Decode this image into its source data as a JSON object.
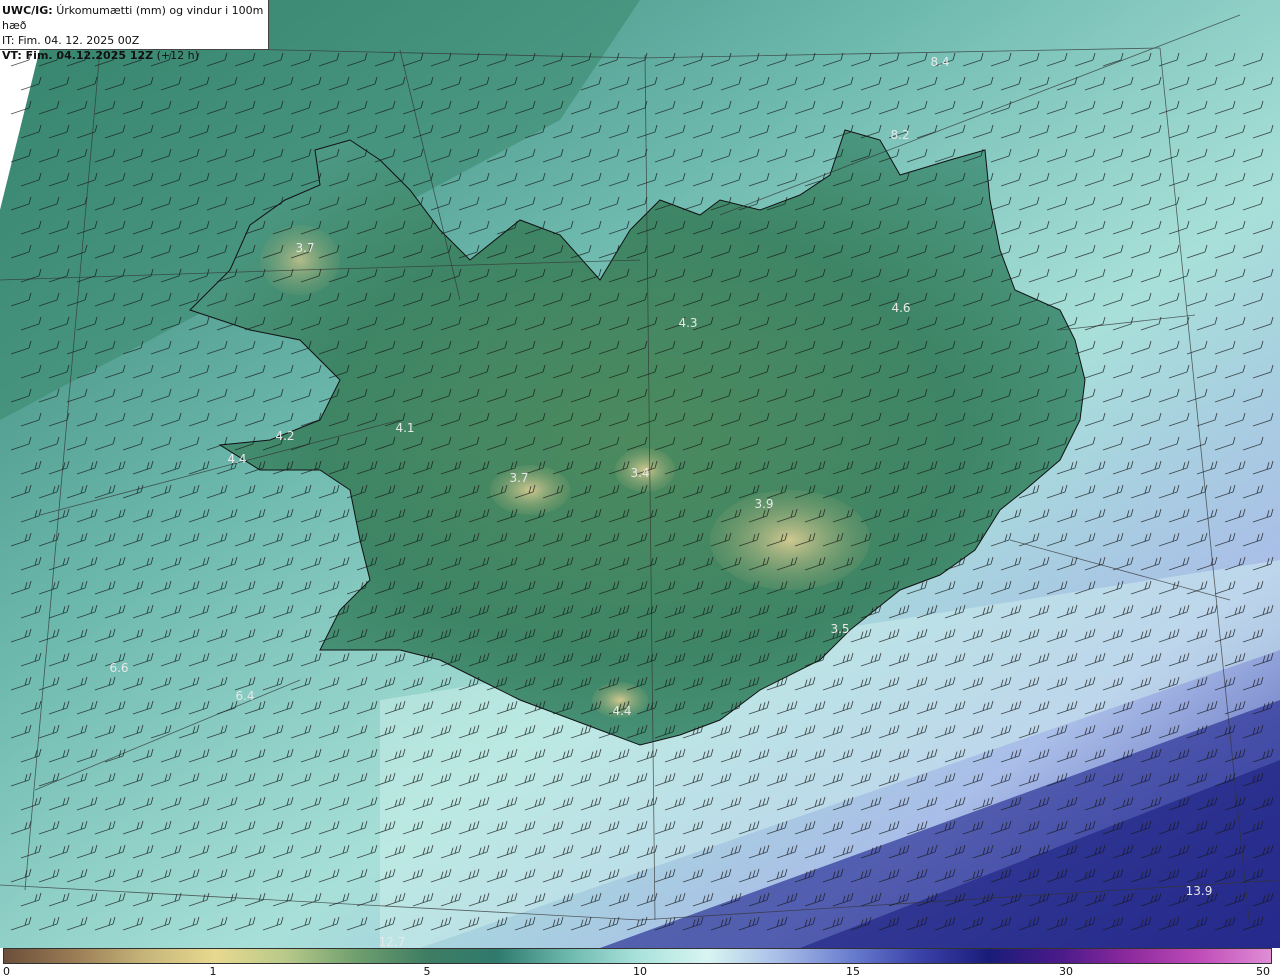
{
  "header": {
    "model": "UWC/IG:",
    "title": "Úrkomumætti (mm) og vindur i 100m hæð",
    "init_time": "IT: Fim. 04. 12. 2025 00Z",
    "valid_prefix": "VT: ",
    "valid_time": "Fim. 04.12.2025 12Z",
    "lead": " (+12 h)"
  },
  "map_labels": [
    {
      "name": "local-max-northwest",
      "text": "3.7"
    },
    {
      "name": "local-max-north-central",
      "text": "4.3"
    },
    {
      "name": "local-max-northeast",
      "text": "4.6"
    },
    {
      "name": "local-max-west",
      "text": "4.4"
    },
    {
      "name": "local-max-west-2",
      "text": "4.2"
    },
    {
      "name": "local-max-west-coast",
      "text": "4.1"
    },
    {
      "name": "local-max-langjokull",
      "text": "3.7"
    },
    {
      "name": "local-max-hofsjokull",
      "text": "3.4"
    },
    {
      "name": "local-max-vatnajokull",
      "text": "3.9"
    },
    {
      "name": "local-max-southeast",
      "text": "3.5"
    },
    {
      "name": "local-max-south",
      "text": "4.4"
    },
    {
      "name": "local-max-sw-sea-1",
      "text": "6.6"
    },
    {
      "name": "local-max-sw-sea-2",
      "text": "6.4"
    },
    {
      "name": "local-max-south-sea",
      "text": "12.7"
    },
    {
      "name": "local-max-se-sea",
      "text": "13.9"
    },
    {
      "name": "local-max-north-sea",
      "text": "8.4"
    },
    {
      "name": "local-max-north-sea-2",
      "text": "8.2"
    }
  ],
  "colorbar": {
    "ticks": [
      "0",
      "1",
      "5",
      "10",
      "15",
      "30",
      "50"
    ],
    "colors": [
      "#6b4f3a",
      "#9a7c55",
      "#c6b579",
      "#e8d98f",
      "#b8c98a",
      "#6f9f6e",
      "#3f7d63",
      "#2f7a6d",
      "#6cb8ad",
      "#a9e2db",
      "#d9f5f2",
      "#a9bde8",
      "#6b7fd0",
      "#3a42a8",
      "#1a1c7a",
      "#4a1a8a",
      "#8e2a9e",
      "#c04db8",
      "#e08ed6"
    ]
  },
  "legend_unit": "mm"
}
